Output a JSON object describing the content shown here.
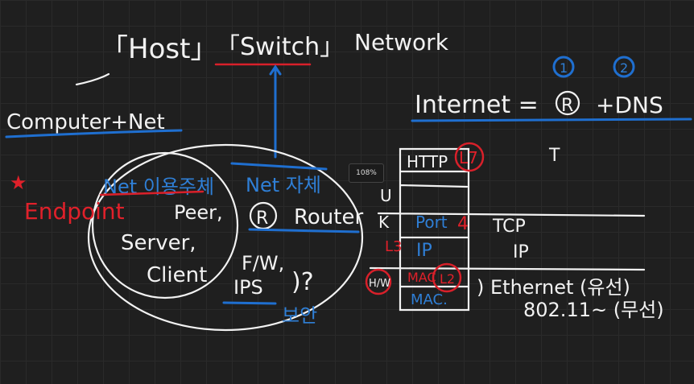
{
  "zoom_level": "108%",
  "top": {
    "host": "「Host」",
    "switch": "「Switch」",
    "network": "Network",
    "computer_net": "Computer+Net",
    "internet": "Internet =",
    "r": "R",
    "plus_dns": "+DNS",
    "n1": "1",
    "n2": "2",
    "t": "T"
  },
  "left": {
    "star": "★",
    "endpoint": "Endpoint",
    "net_user": "Net 이용주체",
    "peer": "Peer,",
    "server": "Server,",
    "client": "Client",
    "net_self": "Net 자체",
    "r": "R",
    "router": "Router",
    "fw": "F/W,",
    "ips": "IPS",
    "question": ")?",
    "security": "보안"
  },
  "stack": {
    "http": "HTTP",
    "l7": "L7",
    "u": "U",
    "k": "K",
    "port": "Port",
    "four": "4",
    "tcp": "TCP",
    "l3": "L3",
    "ip_blue": "IP",
    "ip": "IP",
    "hw": "H/W",
    "mac1": "MAC",
    "l2": "L2",
    "mac2": "MAC.",
    "ethernet": ") Ethernet (유선)",
    "wifi": "802.11~ (무선)"
  },
  "colors": {
    "background": "#1f1f1f",
    "white": "#f2f2f2",
    "blue": "#1f6fd0",
    "red": "#d8202a"
  }
}
